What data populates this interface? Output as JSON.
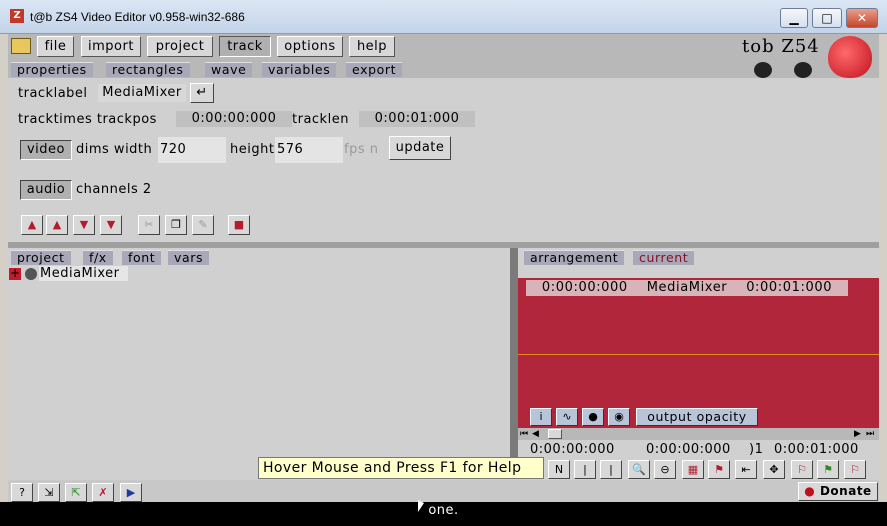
{
  "window": {
    "title": "t@b ZS4 Video Editor v0.958-win32-686",
    "min": "▁",
    "max": "□",
    "close": "✕"
  },
  "menu": {
    "file": "file",
    "import": "import",
    "project": "project",
    "track": "track",
    "options": "options",
    "help": "help"
  },
  "logo": {
    "text": "tob Z54"
  },
  "subtabs": {
    "properties": "properties",
    "rectangles": "rectangles",
    "wave": "wave",
    "variables": "variables",
    "export": "export"
  },
  "track": {
    "tracklabel_label": "tracklabel",
    "tracklabel_value": "MediaMixer",
    "enter_icon": "↵",
    "tracktimes_label": "tracktimes trackpos",
    "trackpos_value": "0:00:00:000",
    "tracklen_label": "tracklen",
    "tracklen_value": "0:00:01:000",
    "video_label": "video",
    "dims_width_label": "dims width",
    "width_value": "720",
    "height_label": "height",
    "height_value": "576",
    "fps_label": "fps n",
    "update_label": "update",
    "audio_label": "audio",
    "channels_label": "channels 2"
  },
  "lowertabs": {
    "project": "project",
    "fx": "f/x",
    "font": "font",
    "vars": "vars"
  },
  "tree": {
    "expand": "+",
    "item": "MediaMixer"
  },
  "righttabs": {
    "arrangement": "arrangement",
    "current": "current"
  },
  "timeline": {
    "start": "0:00:00:000",
    "name": "MediaMixer",
    "end": "0:00:01:000",
    "output_opacity": "output opacity",
    "time1": "0:00:00:000",
    "time2": "0:00:00:000",
    "time3": ")1",
    "time4": "0:00:01:000"
  },
  "tooltip": {
    "text": "Hover Mouse and Press F1 for Help"
  },
  "donate": {
    "label": "Donate"
  },
  "status": {
    "text": "one."
  },
  "colors": {
    "timeline": "#b1263a",
    "tab_active_text": "#8a1020",
    "status_bg": "#000000"
  }
}
